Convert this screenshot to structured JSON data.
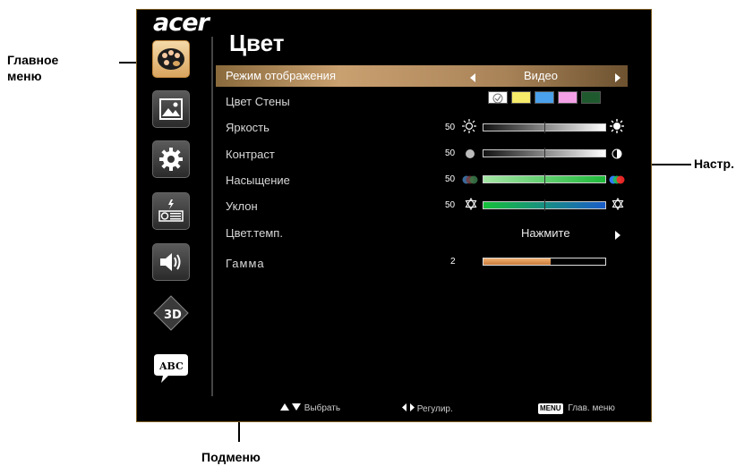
{
  "callouts": {
    "main_menu": "Главное\nменю",
    "settings": "Настр.",
    "submenu": "Подменю"
  },
  "osd": {
    "logo": "acer",
    "title": "Цвет",
    "sidebar": [
      {
        "icon": "palette-icon",
        "active": true
      },
      {
        "icon": "image-icon",
        "active": false
      },
      {
        "icon": "gear-icon",
        "active": false
      },
      {
        "icon": "projector-icon",
        "active": false
      },
      {
        "icon": "speaker-icon",
        "active": false
      },
      {
        "icon": "3d-icon",
        "active": false
      },
      {
        "icon": "language-abc-icon",
        "active": false
      }
    ],
    "rows": {
      "display_mode": {
        "label": "Режим отображения",
        "value": "Видео"
      },
      "wall_color": {
        "label": "Цвет Стены",
        "swatches": [
          "#ffffff",
          "#f7ec6a",
          "#4aa0ea",
          "#f3a0e6",
          "#1f5a2e"
        ]
      },
      "brightness": {
        "label": "Яркость",
        "value": "50",
        "level": 0.5
      },
      "contrast": {
        "label": "Контраст",
        "value": "50",
        "level": 0.5
      },
      "saturation": {
        "label": "Насыщение",
        "value": "50",
        "level": 0.5
      },
      "tint": {
        "label": "Уклон",
        "value": "50",
        "level": 0.5
      },
      "color_temp": {
        "label": "Цвет.темп.",
        "value": "Нажмите"
      },
      "gamma": {
        "label": "Гамма",
        "value": "2",
        "level": 0.55
      }
    },
    "footer": {
      "select": "Выбрать",
      "adjust": "Регулир.",
      "menu_key": "MENU",
      "main_menu": "Глав. меню"
    }
  },
  "colors": {
    "accent": "#c9a070",
    "background": "#000000"
  }
}
